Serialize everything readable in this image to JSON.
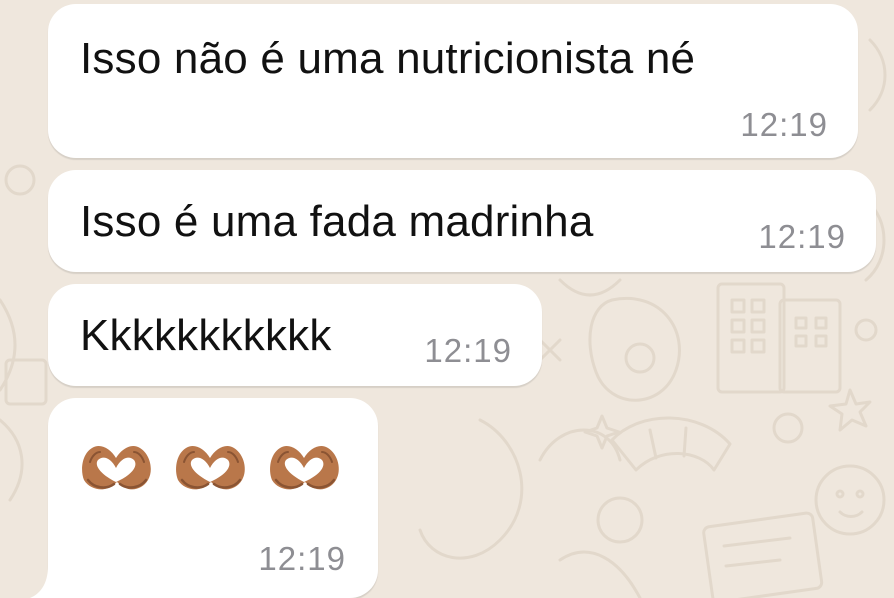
{
  "chat": {
    "messages": [
      {
        "text": "Isso não é uma nutricionista né",
        "time": "12:19"
      },
      {
        "text": "Isso é uma fada madrinha",
        "time": "12:19"
      },
      {
        "text": "Kkkkkkkkkkk",
        "time": "12:19"
      },
      {
        "emojis": [
          "heart-hands",
          "heart-hands",
          "heart-hands"
        ],
        "time": "12:19"
      }
    ]
  },
  "theme": {
    "bubble_color": "#ffffff",
    "wallpaper_color": "#efe7dd",
    "text_color": "#111111",
    "timestamp_color": "#8e8e93",
    "emoji_skin_color": "#b9774a"
  }
}
